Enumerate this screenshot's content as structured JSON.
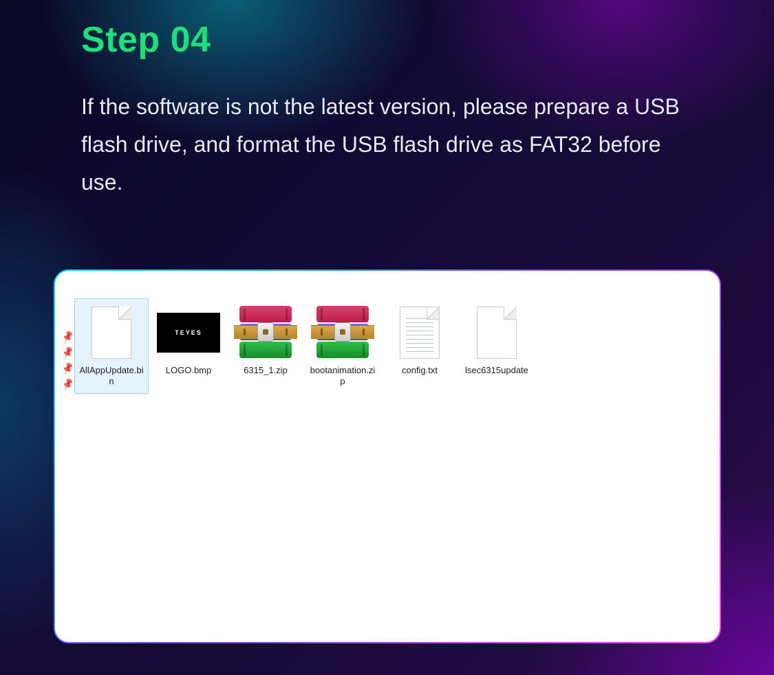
{
  "step": {
    "title": "Step 04",
    "body": "If the software is not the latest version, please prepare a USB flash drive, and format the USB flash drive as FAT32 before use."
  },
  "file_panel": {
    "files": [
      {
        "name": "AllAppUpdate.bin",
        "icon": "blank",
        "selected": true
      },
      {
        "name": "LOGO.bmp",
        "icon": "bmp",
        "bmp_text": "TEYES",
        "selected": false
      },
      {
        "name": "6315_1.zip",
        "icon": "zip",
        "selected": false
      },
      {
        "name": "bootanimation.zip",
        "icon": "zip",
        "selected": false
      },
      {
        "name": "config.txt",
        "icon": "txt",
        "selected": false
      },
      {
        "name": "lsec6315update",
        "icon": "blank",
        "selected": false
      }
    ],
    "pins": [
      "📌",
      "📌",
      "📌",
      "📌"
    ]
  }
}
